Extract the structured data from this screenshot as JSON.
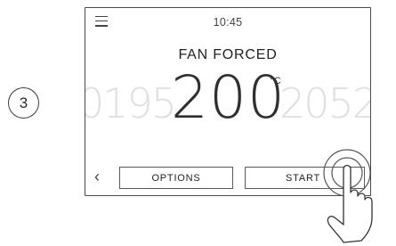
{
  "step": {
    "number": "3"
  },
  "header": {
    "time": "10:45"
  },
  "mode": {
    "label": "FAN FORCED"
  },
  "temperature": {
    "previous_values": "0195",
    "current": "200",
    "next_values": "2052",
    "unit": "°C"
  },
  "footer": {
    "options_label": "OPTIONS",
    "start_label": "START"
  },
  "icons": [
    "menu-icon",
    "chevron-left-icon",
    "hand-tap-icon"
  ]
}
